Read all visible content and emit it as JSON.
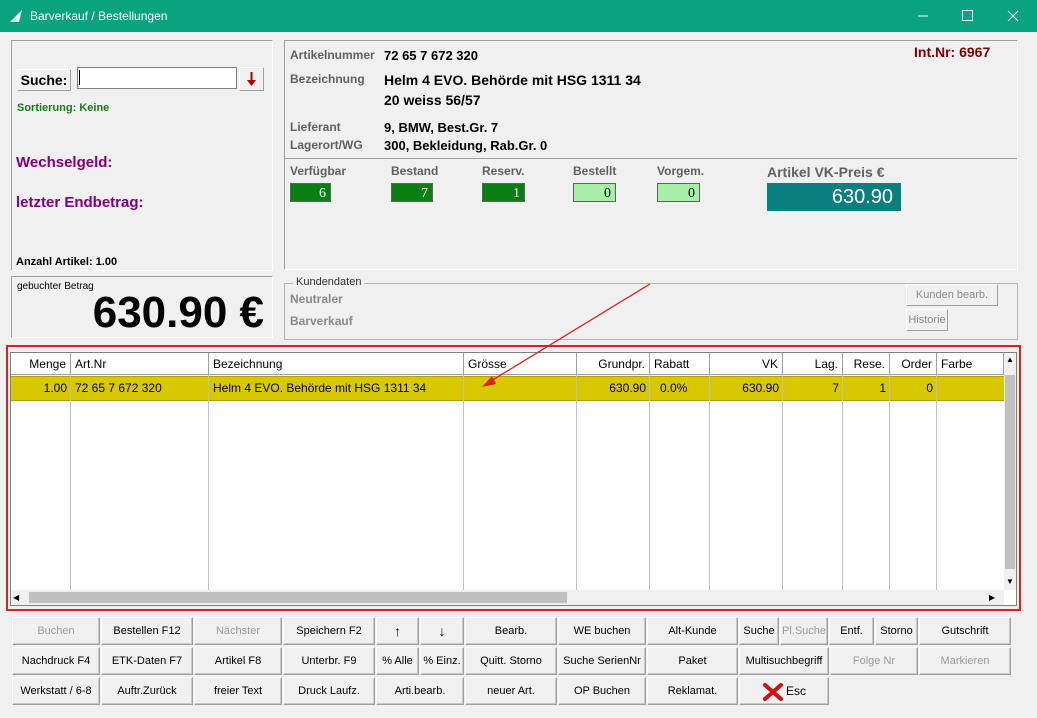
{
  "window": {
    "title": "Barverkauf / Bestellungen"
  },
  "search": {
    "label": "Suche:",
    "value": "",
    "sort": "Sortierung: Keine"
  },
  "left": {
    "wechselgeld": "Wechselgeld:",
    "endbetrag": "letzter Endbetrag:",
    "anzahl": "Anzahl Artikel: 1.00",
    "gebucht_label": "gebuchter Betrag",
    "gebucht_value": "630.90 €"
  },
  "article": {
    "artnr_label": "Artikelnummer",
    "artnr": "72 65 7 672 320",
    "bez_label": "Bezeichnung",
    "bez1": "Helm 4 EVO. Behörde mit HSG 1311 34",
    "bez2": "20 weiss 56/57",
    "lief_label": "Lieferant",
    "lief": "9, BMW, Best.Gr. 7",
    "lager_label": "Lagerort/WG",
    "lager": "300, Bekleidung, Rab.Gr. 0",
    "intnr": "Int.Nr: 6967",
    "price_label": "Artikel VK-Preis €",
    "price": "630.90"
  },
  "stock": [
    {
      "label": "Verfügbar",
      "value": "6"
    },
    {
      "label": "Bestand",
      "value": "7"
    },
    {
      "label": "Reserv.",
      "value": "1"
    },
    {
      "label": "Bestellt",
      "value": "0"
    },
    {
      "label": "Vorgem.",
      "value": "0"
    }
  ],
  "kunde": {
    "group": "Kundendaten",
    "line1": "Neutraler",
    "line2": "Barverkauf",
    "btn_edit": "Kunden bearb.",
    "btn_hist": "Historie"
  },
  "grid": {
    "headers": [
      "Menge",
      "Art.Nr",
      "Bezeichnung",
      "Grösse",
      "Grundpr.",
      "Rabatt",
      "VK",
      "Lag.",
      "Rese.",
      "Order",
      "Farbe"
    ],
    "rows": [
      [
        "1.00",
        "72 65 7 672 320",
        "Helm 4 EVO. Behörde mit HSG 1311 34",
        "",
        "630.90",
        "0.0%",
        "630.90",
        "7",
        "1",
        "0",
        ""
      ]
    ]
  },
  "buttons": {
    "row1": [
      "Buchen",
      "Bestellen F12",
      "Nächster",
      "Speichern F2",
      "↑",
      "↓",
      "Bearb.",
      "WE buchen",
      "Alt-Kunde",
      "Suche",
      "Pl.Suche",
      "Entf.",
      "Storno",
      "Gutschrift"
    ],
    "row2": [
      "Nachdruck F4",
      "ETK-Daten F7",
      "Artikel F8",
      "Unterbr. F9",
      "% Alle",
      "% Einz.",
      "Quitt. Storno",
      "Suche SerienNr",
      "Paket",
      "Multisuchbegriff",
      "Folge Nr",
      "Markieren"
    ],
    "row3": [
      "Werkstatt / 6-8",
      "Auftr.Zurück",
      "freier Text",
      "Druck Laufz.",
      "Arti.bearb.",
      "neuer Art.",
      "OP Buchen",
      "Reklamat.",
      "Esc"
    ]
  },
  "colors": {
    "titlebar": "#0aa37f",
    "row_highlight": "#d8c800",
    "price_box": "#0a7f7f",
    "stock_dark": "#0a7f14",
    "stock_light": "#a8f0a8",
    "annotation": "#e02020"
  }
}
